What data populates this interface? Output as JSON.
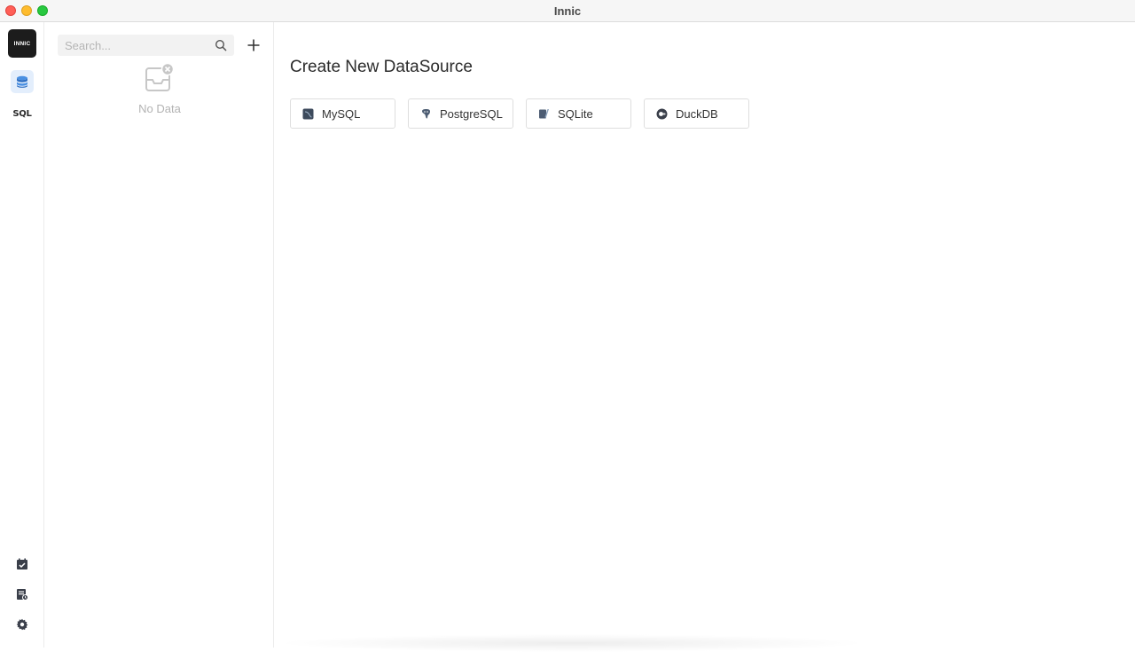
{
  "window": {
    "title": "Innic"
  },
  "activity_bar": {
    "logo_text": "INNIC",
    "items": [
      {
        "name": "datasource",
        "icon": "database-icon",
        "active": true
      },
      {
        "name": "sql",
        "label": "SQL",
        "active": false
      }
    ],
    "bottom_items": [
      {
        "icon": "task-icon"
      },
      {
        "icon": "log-icon"
      },
      {
        "icon": "gear-icon"
      }
    ]
  },
  "sidebar": {
    "search": {
      "placeholder": "Search...",
      "value": ""
    },
    "add_icon": "plus-icon",
    "empty": {
      "icon": "empty-inbox-icon",
      "text": "No Data"
    }
  },
  "main": {
    "title": "Create New DataSource",
    "datasources": [
      {
        "label": "MySQL",
        "icon": "mysql-icon"
      },
      {
        "label": "PostgreSQL",
        "icon": "postgresql-icon"
      },
      {
        "label": "SQLite",
        "icon": "sqlite-icon"
      },
      {
        "label": "DuckDB",
        "icon": "duckdb-icon"
      }
    ]
  },
  "colors": {
    "accent_bg": "#e3eefc",
    "accent": "#4a90e2",
    "traffic_close": "#ff5f57",
    "traffic_min": "#febc2e",
    "traffic_max": "#28c840"
  }
}
